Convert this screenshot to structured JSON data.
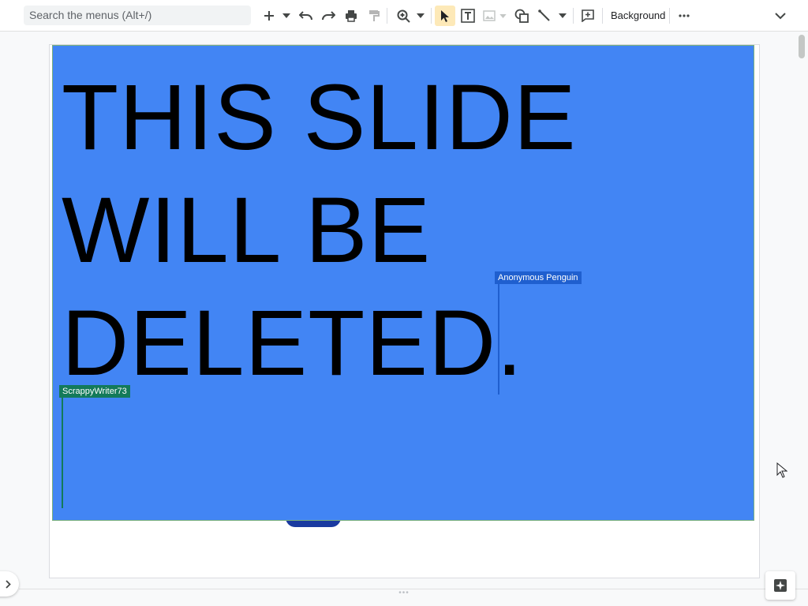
{
  "toolbar": {
    "search_placeholder": "Search the menus (Alt+/)",
    "background_label": "Background"
  },
  "slide": {
    "lines": [
      "THIS SLIDE",
      "WILL BE",
      "DELETED."
    ],
    "background_color": "#4285f4"
  },
  "collaborators": [
    {
      "name": "Anonymous Penguin",
      "color": "#1f5fcf"
    },
    {
      "name": "ScrappyWriter73",
      "color": "#137a5a"
    }
  ]
}
